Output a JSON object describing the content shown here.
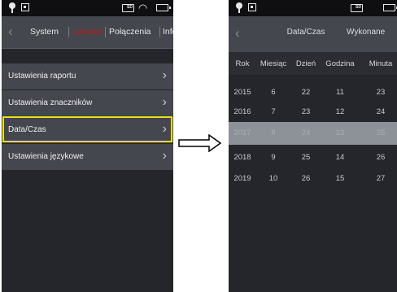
{
  "left_screen": {
    "tabs": [
      {
        "label": "System",
        "active": false
      },
      {
        "label": "Lokalne",
        "active": true
      },
      {
        "label": "Połączenia",
        "active": false
      },
      {
        "label": "Info",
        "active": false
      }
    ],
    "menu_items": [
      {
        "label": "Ustawienia raportu",
        "highlighted": false
      },
      {
        "label": "Ustawienia znaczników",
        "highlighted": false
      },
      {
        "label": "Data/Czas",
        "highlighted": true
      },
      {
        "label": "Ustawienia językowe",
        "highlighted": false
      }
    ],
    "status_icons": {
      "sd": "SD"
    }
  },
  "right_screen": {
    "title": "Data/Czas",
    "action": "Wykonane",
    "columns": [
      "Rok",
      "Miesiąc",
      "Dzień",
      "Godzina",
      "Minuta"
    ],
    "rows": [
      [
        "2015",
        "6",
        "22",
        "11",
        "23"
      ],
      [
        "2016",
        "7",
        "23",
        "12",
        "24"
      ],
      [
        "2017",
        "8",
        "24",
        "13",
        "25"
      ],
      [
        "2018",
        "9",
        "25",
        "14",
        "26"
      ],
      [
        "2019",
        "10",
        "26",
        "15",
        "27"
      ]
    ],
    "selected_row_index": 2,
    "status_icons": {
      "sd": "SD"
    }
  },
  "colors": {
    "highlight_border": "#e8e200",
    "active_tab": "#c4161c",
    "selected_row": "#8d9198"
  },
  "icons": [
    "location-pin-icon",
    "gallery-icon",
    "sd-card-icon",
    "wifi-icon",
    "battery-icon",
    "back-chevron-icon",
    "chevron-right-icon",
    "arrow-right-icon"
  ]
}
